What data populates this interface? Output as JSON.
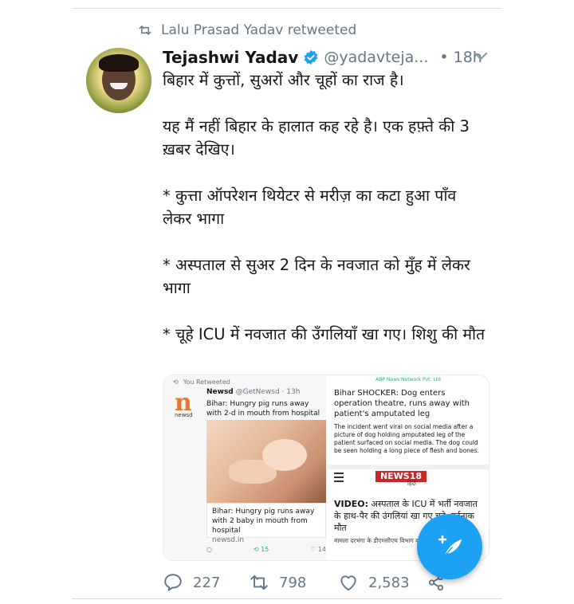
{
  "retweet_context": {
    "text": "Lalu Prasad Yadav retweeted"
  },
  "tweet": {
    "author_name": "Tejashwi Yadav",
    "handle": "@yadavteja...",
    "time": "• 18h",
    "lines": [
      "बिहार में कुत्तों, सुअरों और चूहों का राज है।",
      "यह मैं नहीं बिहार के हालात कह रहे है। एक हफ़्ते की 3 ख़बर देखिए।",
      "* कुत्ता ऑपरेशन थियेटर से मरीज़ का कटा हुआ पाँव लेकर भागा",
      "* अस्पताल से सुअर 2 दिन के नवजात को मुँह में लेकर भागा",
      "* चूहे ICU में नवजात की उँगलियाँ खा गए। शिशु की मौत"
    ]
  },
  "media": {
    "left": {
      "rt_label": "You Retweeted",
      "logo_sub": "newsd",
      "account": "Newsd",
      "handle_time": "@GetNewsd · 13h",
      "text": "Bihar: Hungry pig runs away with 2-d in mouth from hospital",
      "card_title": "Bihar: Hungry pig runs away with 2 baby in mouth from hospital",
      "card_domain": "newsd.in",
      "rt_count": "15",
      "like_count": "14"
    },
    "right_top": {
      "source": "ABP News Network Pvt. Ltd",
      "title": "Bihar SHOCKER: Dog enters operation theatre, runs away with patient's amputated leg",
      "body": "The incident went viral on social media after a picture of dog holding amputated leg of the patient surfaced on social media. The dog could be seen holding a long piece of flesh and bones."
    },
    "right_bottom": {
      "brand": "NEWS18",
      "sub": "हिंदी",
      "video_prefix": "VIDEO:",
      "video_text": "अस्पताल के ICU में भर्ती नवजात के हाथ-पैर की उंगलियां खा गए चूहे, दर्दनाक मौत",
      "detail": "मामला दरभंगा के डीएमसीएच विभाग का है. जानकारी के मुता"
    }
  },
  "actions": {
    "replies": "227",
    "retweets": "798",
    "likes": "2,583"
  },
  "colors": {
    "accent": "#1da1f2",
    "muted": "#657786",
    "retweet_green": "#17bf63"
  }
}
